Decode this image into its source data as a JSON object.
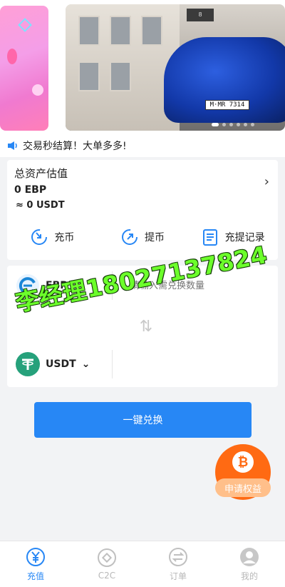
{
  "banner": {
    "plate": "M·MR 7314",
    "tag": "8"
  },
  "notice": {
    "text": "交易秒结算！大单多多!"
  },
  "assets": {
    "title": "总资产估值",
    "value_ebp": "0 EBP",
    "value_usdt": "≈ 0 USDT",
    "actions": [
      {
        "label": "充币",
        "icon": "deposit-icon"
      },
      {
        "label": "提币",
        "icon": "withdraw-icon"
      },
      {
        "label": "充提记录",
        "icon": "record-icon"
      }
    ]
  },
  "exchange": {
    "from_coin": "EBP",
    "to_coin": "USDT",
    "placeholder": "请输入需兑换数量",
    "button": "一键兑换"
  },
  "overlay": {
    "text": "李经理18027137824"
  },
  "fab": {
    "label": "申请权益"
  },
  "tabbar": {
    "tabs": [
      {
        "label": "充值",
        "active": true
      },
      {
        "label": "C2C",
        "active": false
      },
      {
        "label": "订单",
        "active": false
      },
      {
        "label": "我的",
        "active": false
      }
    ]
  },
  "colors": {
    "accent": "#2787f5",
    "orange": "#ff6a13",
    "overlay_green": "#6cff2b"
  }
}
